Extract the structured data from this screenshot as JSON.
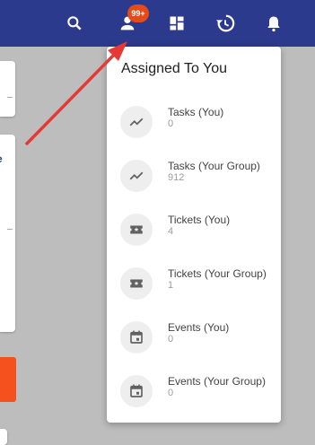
{
  "header": {
    "icons": [
      "search-icon",
      "person-icon",
      "dashboard-icon",
      "history-icon",
      "bell-icon"
    ],
    "badge": "99+"
  },
  "background": {
    "partial_letter": "e"
  },
  "menu": {
    "title": "Assigned To You",
    "items": [
      {
        "label": "Tasks (You)",
        "count": "0",
        "icon": "trending-icon"
      },
      {
        "label": "Tasks (Your Group)",
        "count": "912",
        "icon": "trending-icon"
      },
      {
        "label": "Tickets (You)",
        "count": "4",
        "icon": "ticket-icon"
      },
      {
        "label": "Tickets (Your Group)",
        "count": "1",
        "icon": "ticket-icon"
      },
      {
        "label": "Events (You)",
        "count": "0",
        "icon": "calendar-icon"
      },
      {
        "label": "Events (Your Group)",
        "count": "0",
        "icon": "calendar-icon"
      }
    ]
  },
  "colors": {
    "header": "#2c3a8e",
    "badge": "#e64a19",
    "annotation_arrow": "#e53935",
    "accent": "#f4511e"
  }
}
